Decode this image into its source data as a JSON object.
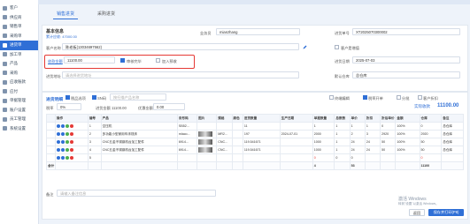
{
  "sidebar": {
    "items": [
      {
        "label": "客户",
        "active": false
      },
      {
        "label": "供应商",
        "active": false
      },
      {
        "label": "销售单",
        "active": false
      },
      {
        "label": "采购单",
        "active": false
      },
      {
        "label": "进货单",
        "active": true
      },
      {
        "label": "加工单",
        "active": false
      },
      {
        "label": "产品",
        "active": false
      },
      {
        "label": "采购",
        "active": false
      },
      {
        "label": "应收账款",
        "active": false
      },
      {
        "label": "应付",
        "active": false
      },
      {
        "label": "单据管理",
        "active": false
      },
      {
        "label": "账户设置",
        "active": false
      },
      {
        "label": "员工管理",
        "active": false
      },
      {
        "label": "系统设置",
        "active": false
      }
    ]
  },
  "tabs": [
    {
      "label": "销售进货",
      "active": true
    },
    {
      "label": "采购进货",
      "active": false
    }
  ],
  "form": {
    "section_title": "基本信息",
    "section_sub": "累计应收: 47000.00",
    "salesman_label": "业务员",
    "salesman_value": "mianzhang",
    "doc_no_label": "进货单号",
    "doc_no_value": "XT2025070300002",
    "customer_label": "客户名称",
    "customer_value": "陈老板(13034697562)",
    "tax_label": "客户是增值",
    "received_label": "收款金额",
    "received_value": "11100.00",
    "check_label": "审核完毕",
    "check2_label": "加入预收",
    "date_label": "进货日期",
    "date_value": "2025-07-03",
    "addr_label": "进货地址",
    "addr_placeholder": "请选择进货地址",
    "warehouse_label": "默认仓库",
    "warehouse_value": "总仓库"
  },
  "detail": {
    "title": "进货明细",
    "opt1": "税品选项",
    "opt2": "SN码",
    "search_placeholder": "按扫描产品名称",
    "total_received_label": "进货金额",
    "total_received_value": "11100.00",
    "discount_label": "优惠金额",
    "discount_value": "0.00",
    "tax_rate_label": "税率",
    "tax_rate_value": "0%",
    "amount_label": "实际收款",
    "amount_value": "11100.00",
    "right_opts": [
      "终端编辑",
      "税率开单",
      "分批",
      "客户折扣"
    ],
    "columns": [
      "",
      "操作",
      "编号",
      "产品",
      "条形码",
      "图片",
      "规格",
      "颜色",
      "进货数量",
      "生产日期",
      "单据数量",
      "总数数",
      "单价",
      "折扣",
      "折后单价",
      "金额",
      "仓库",
      "备注"
    ],
    "rows": [
      {
        "no": "1",
        "product": "空压机",
        "barcode": "SB52...",
        "img": false,
        "spec": "",
        "color": "",
        "qty": "11",
        "date": "",
        "doc_qty": "1",
        "n1": "1",
        "n2": "1",
        "price": "1",
        "disc": "0",
        "dprice": "100%",
        "amount": "0",
        "warehouse": "总仓库"
      },
      {
        "no": "2",
        "product": "多功能小型家用车床铣床",
        "barcode": "mlaco...",
        "img": true,
        "spec": "MR2...",
        "color": "",
        "qty": "197",
        "date": "2024-07-01",
        "doc_qty": "2000",
        "n1": "1",
        "n2": "2",
        "price": "3",
        "disc": "2920",
        "dprice": "100%",
        "amount": "2920",
        "warehouse": "总仓库"
      },
      {
        "no": "3",
        "product": "CNC五金不锈钢机台加工配件",
        "barcode": "6914...",
        "img": true,
        "spec": "CNC...",
        "color": "",
        "qty": "119.541671",
        "date": "",
        "doc_qty": "1000",
        "n1": "1",
        "n2": "24",
        "price": "24",
        "disc": "50",
        "dprice": "100%",
        "amount": "50",
        "warehouse": "总仓库"
      },
      {
        "no": "4",
        "product": "CNC五金不锈钢机台加工配件",
        "barcode": "6914...",
        "img": true,
        "spec": "CNC...",
        "color": "",
        "qty": "119.541671",
        "date": "",
        "doc_qty": "1000",
        "n1": "1",
        "n2": "24",
        "price": "24",
        "disc": "50",
        "dprice": "100%",
        "amount": "50",
        "warehouse": "总仓库"
      },
      {
        "no": "5",
        "product": "",
        "barcode": "",
        "img": false,
        "spec": "",
        "color": "",
        "qty": "",
        "date": "",
        "doc_qty": "0",
        "n1": "0",
        "n2": "0",
        "price": "",
        "disc": "",
        "dprice": "",
        "amount": "0",
        "warehouse": ""
      }
    ],
    "sum_label": "合计",
    "sum_qty": "4",
    "sum_n2": "53",
    "sum_amount": "11100",
    "remark_label": "备注",
    "remark_placeholder": "请输入备注信息"
  },
  "footer": {
    "cancel": "返回",
    "save": "保存并打印(P8)",
    "watermark1": "激活 Windows",
    "watermark2": "转到\"设置\"以激活 Windows。"
  },
  "colors": {
    "accent": "#2f6fd6",
    "highlight": "#e53935"
  }
}
